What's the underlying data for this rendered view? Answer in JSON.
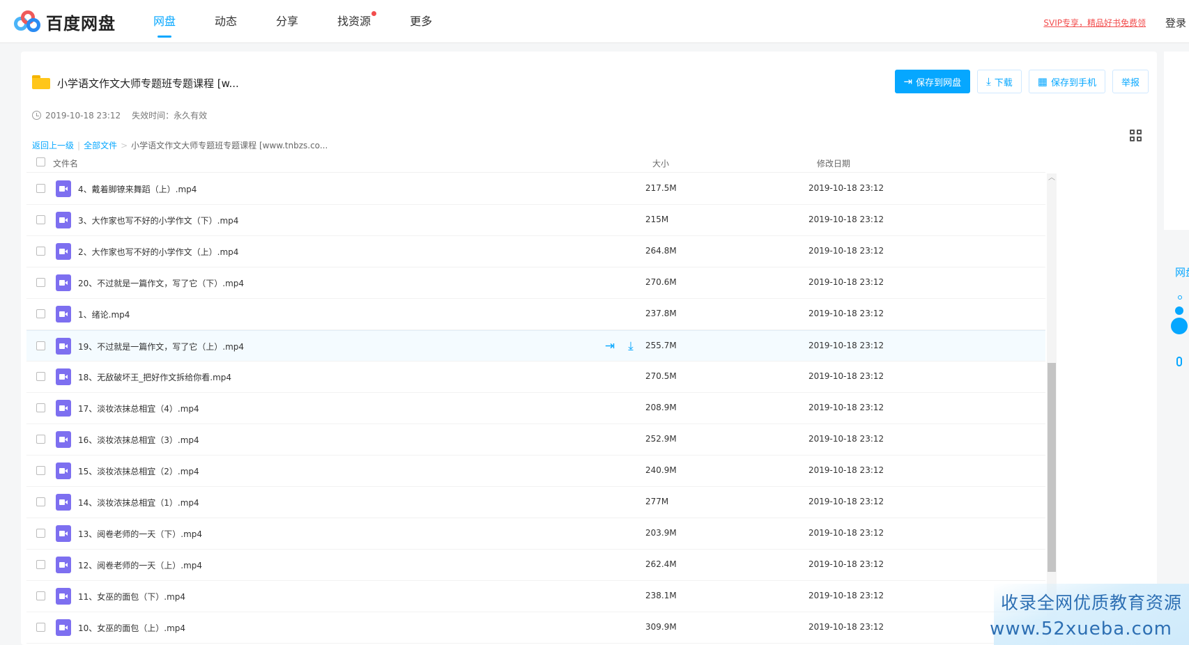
{
  "brand": {
    "name": "百度网盘"
  },
  "nav": {
    "items": [
      {
        "label": "网盘",
        "active": true
      },
      {
        "label": "动态",
        "active": false
      },
      {
        "label": "分享",
        "active": false
      },
      {
        "label": "找资源",
        "active": false
      },
      {
        "label": "更多",
        "active": false
      }
    ]
  },
  "header": {
    "promo": "SVIP专享，精品好书免费领",
    "login": "登录"
  },
  "share": {
    "title": "小学语文作文大师专题班专题课程 [w...",
    "created": "2019-10-18 23:12",
    "expire_label": "失效时间：永久有效"
  },
  "actions": {
    "save_to_disk": "保存到网盘",
    "download": "下载",
    "save_to_phone": "保存到手机",
    "report": "举报"
  },
  "breadcrumb": {
    "back": "返回上一级",
    "all_files": "全部文件",
    "separator": "|",
    "arrow": ">",
    "current": "小学语文作文大师专题班专题课程 [www.tnbzs.co..."
  },
  "table": {
    "headers": {
      "name": "文件名",
      "size": "大小",
      "date": "修改日期"
    },
    "rows": [
      {
        "name": "4、戴着脚镣来舞蹈（上）.mp4",
        "size": "217.5M",
        "date": "2019-10-18 23:12"
      },
      {
        "name": "3、大作家也写不好的小学作文（下）.mp4",
        "size": "215M",
        "date": "2019-10-18 23:12"
      },
      {
        "name": "2、大作家也写不好的小学作文（上）.mp4",
        "size": "264.8M",
        "date": "2019-10-18 23:12"
      },
      {
        "name": "20、不过就是一篇作文，写了它（下）.mp4",
        "size": "270.6M",
        "date": "2019-10-18 23:12"
      },
      {
        "name": "1、绪论.mp4",
        "size": "237.8M",
        "date": "2019-10-18 23:12"
      },
      {
        "name": "19、不过就是一篇作文，写了它（上）.mp4",
        "size": "255.7M",
        "date": "2019-10-18 23:12"
      },
      {
        "name": "18、无敌破坏王_把好作文拆给你看.mp4",
        "size": "270.5M",
        "date": "2019-10-18 23:12"
      },
      {
        "name": "17、淡妆浓抹总相宜（4）.mp4",
        "size": "208.9M",
        "date": "2019-10-18 23:12"
      },
      {
        "name": "16、淡妆浓抹总相宜（3）.mp4",
        "size": "252.9M",
        "date": "2019-10-18 23:12"
      },
      {
        "name": "15、淡妆浓抹总相宜（2）.mp4",
        "size": "240.9M",
        "date": "2019-10-18 23:12"
      },
      {
        "name": "14、淡妆浓抹总相宜（1）.mp4",
        "size": "277M",
        "date": "2019-10-18 23:12"
      },
      {
        "name": "13、阅卷老师的一天（下）.mp4",
        "size": "203.9M",
        "date": "2019-10-18 23:12"
      },
      {
        "name": "12、阅卷老师的一天（上）.mp4",
        "size": "262.4M",
        "date": "2019-10-18 23:12"
      },
      {
        "name": "11、女巫的面包（下）.mp4",
        "size": "238.1M",
        "date": "2019-10-18 23:12"
      },
      {
        "name": "10、女巫的面包（上）.mp4",
        "size": "309.9M",
        "date": "2019-10-18 23:12"
      }
    ],
    "hover_row_index": 5
  },
  "side": {
    "label": "网盘"
  },
  "watermark": {
    "line1": "收录全网优质教育资源",
    "line2": "www.52xueba.com"
  },
  "colors": {
    "accent": "#06a7ff",
    "video_icon": "#7d6ff0",
    "promo": "#f24d4d",
    "folder": "#ffc61a"
  },
  "icons": {
    "save": "save-to-disk-icon",
    "download": "download-icon",
    "phone": "qr-phone-icon",
    "clock": "clock-icon",
    "grid": "grid-view-icon",
    "video": "video-file-icon"
  }
}
